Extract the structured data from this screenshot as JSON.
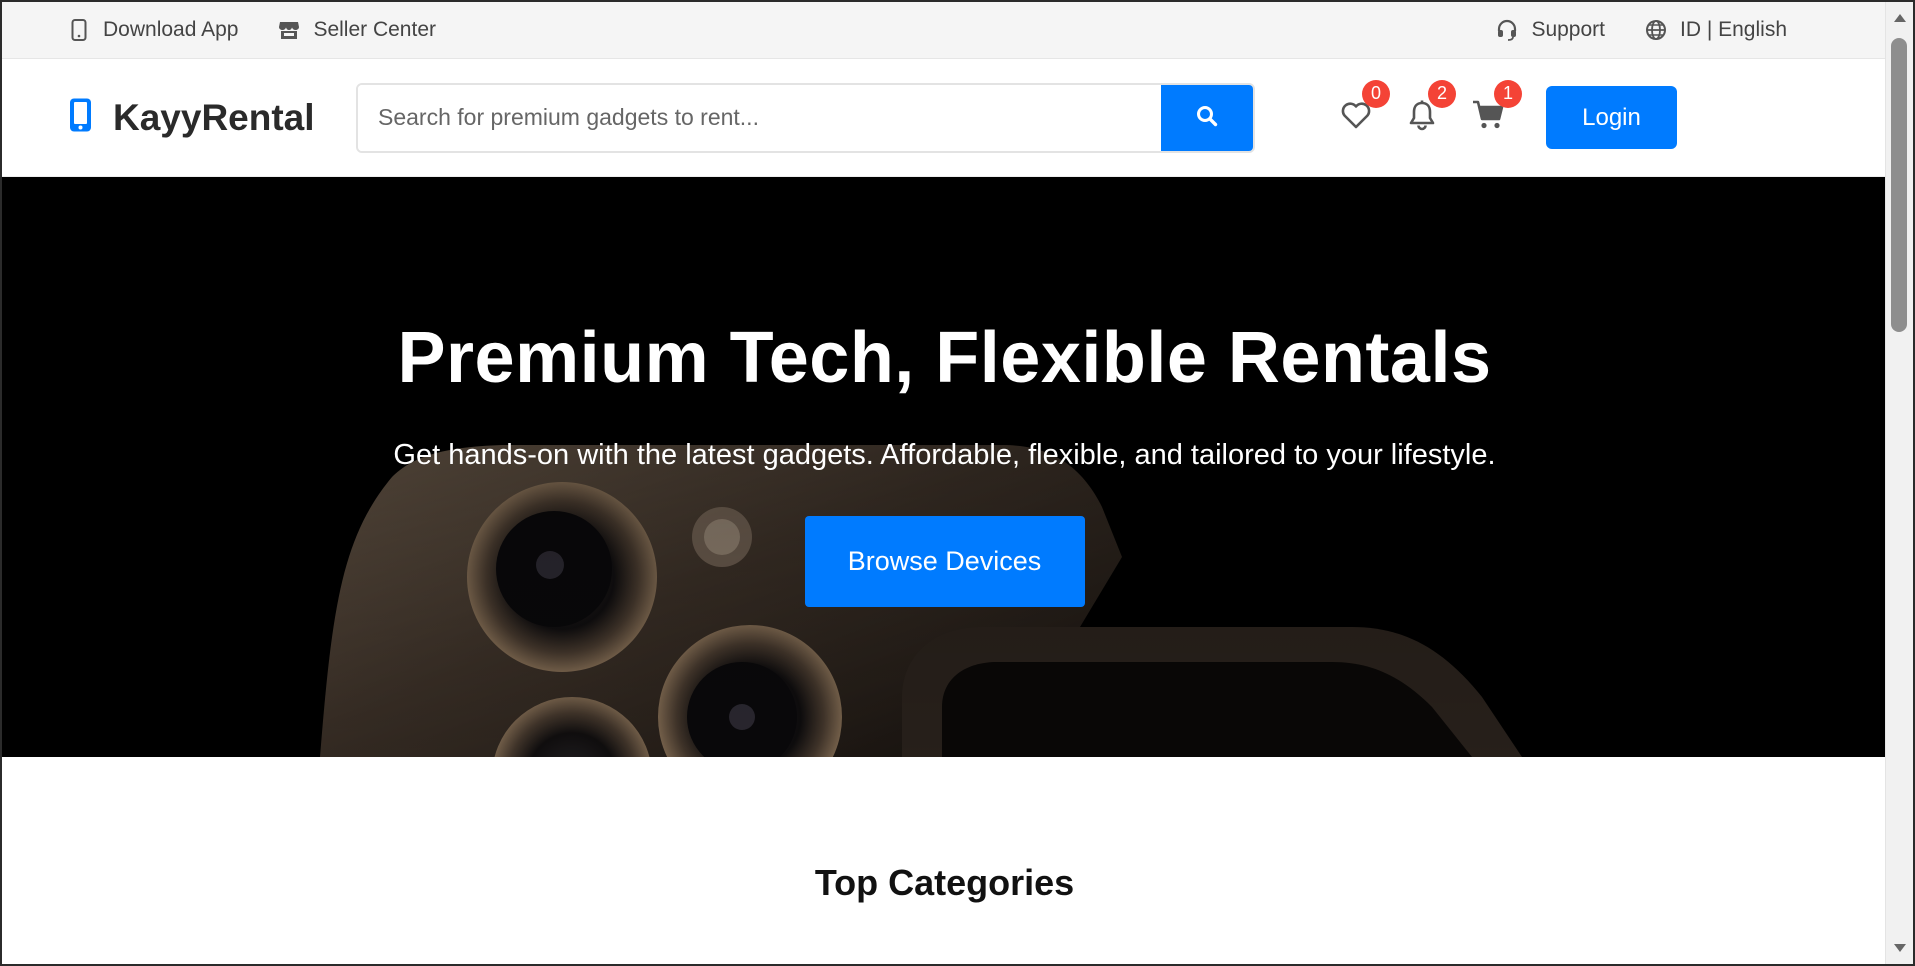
{
  "topbar": {
    "download_app": "Download App",
    "seller_center": "Seller Center",
    "support": "Support",
    "language": "ID | English"
  },
  "header": {
    "logo_text": "KayyRental",
    "search_placeholder": "Search for premium gadgets to rent...",
    "wishlist_count": "0",
    "notification_count": "2",
    "cart_count": "1",
    "login_label": "Login"
  },
  "hero": {
    "title": "Premium Tech, Flexible Rentals",
    "subtitle": "Get hands-on with the latest gadgets. Affordable, flexible, and tailored to your lifestyle.",
    "cta_label": "Browse Devices"
  },
  "categories": {
    "title": "Top Categories"
  },
  "icons": {
    "download_app": "mobile-icon",
    "seller_center": "store-icon",
    "support": "headset-icon",
    "language": "globe-icon",
    "logo": "phone-icon",
    "search": "search-icon",
    "wishlist": "heart-icon",
    "notifications": "bell-icon",
    "cart": "cart-icon"
  },
  "colors": {
    "accent": "#007bff",
    "badge": "#f44336",
    "hero_background": "#000000"
  }
}
